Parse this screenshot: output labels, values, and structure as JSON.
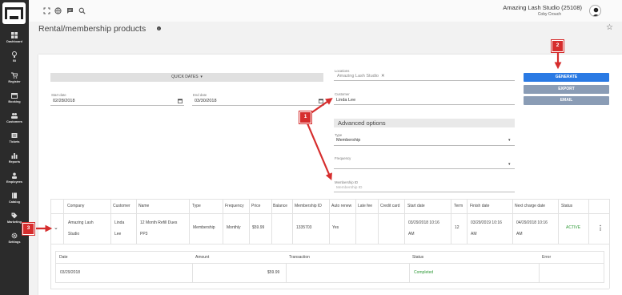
{
  "sidebar": {
    "items": [
      {
        "label": "Dashboard",
        "icon": "dashboard-icon"
      },
      {
        "label": "BI",
        "icon": "lightbulb-icon"
      },
      {
        "label": "Register",
        "icon": "cart-icon"
      },
      {
        "label": "Booking",
        "icon": "calendar-icon"
      },
      {
        "label": "Customers",
        "icon": "people-icon"
      },
      {
        "label": "Tickets",
        "icon": "ticket-icon"
      },
      {
        "label": "Reports",
        "icon": "bar-chart-icon"
      },
      {
        "label": "Employees",
        "icon": "person-icon"
      },
      {
        "label": "Catalog",
        "icon": "book-icon"
      },
      {
        "label": "Marketing",
        "icon": "tag-icon"
      },
      {
        "label": "Settings",
        "icon": "gear-icon"
      }
    ]
  },
  "header": {
    "studio": "Amazing Lash Studio (25108)",
    "user": "Coby Crouch"
  },
  "page": {
    "title": "Rental/membership products",
    "info": "i"
  },
  "filters": {
    "quick_dates": "QUICK DATES",
    "start_date_label": "Start date",
    "start_date": "02/28/2018",
    "end_date_label": "End date",
    "end_date": "03/30/2018",
    "locations_label": "Locations",
    "location_chip": "Amazing Lash Studio",
    "customer_label": "Customer",
    "customer": "Linda Lee",
    "advanced": "Advanced options",
    "type_label": "Type",
    "type": "Membership",
    "frequency_label": "Frequency",
    "frequency": "",
    "membership_id_label": "Membership ID",
    "membership_id_placeholder": "Membership ID"
  },
  "buttons": {
    "generate": "GENERATE",
    "export": "EXPORT",
    "email": "EMAIL"
  },
  "table": {
    "headers": [
      "Company",
      "Customer",
      "Name",
      "Type",
      "Frequency",
      "Price",
      "Balance",
      "Membership ID",
      "Auto renew",
      "Late fee",
      "Credit card",
      "Start date",
      "Term",
      "Finish date",
      "Next charge date",
      "Status"
    ],
    "row": {
      "company_1": "Amazing Lash",
      "company_2": "Studio",
      "customer_1": "Linda",
      "customer_2": "Lee",
      "name_1": "12 Month Refill Dues",
      "name_2": "PP3",
      "type": "Membership",
      "frequency": "Monthly",
      "price": "$59.99",
      "balance": "",
      "membership_id": "1335703",
      "auto_renew": "Yes",
      "late_fee": "",
      "credit_card": "",
      "start_1": "03/29/2018 10:16",
      "start_2": "AM",
      "term": "12",
      "finish_1": "03/29/2019 10:16",
      "finish_2": "AM",
      "next_1": "04/29/2018 10:16",
      "next_2": "AM",
      "status": "ACTIVE"
    },
    "sub_headers": [
      "Date",
      "Amount",
      "Transaction",
      "Status",
      "Error"
    ],
    "sub_row": {
      "date": "03/29/2018",
      "amount": "$59.99",
      "transaction": "",
      "status": "Completed",
      "error": ""
    }
  },
  "annotations": {
    "badge_1": "1",
    "badge_2": "2",
    "badge_3": "3",
    "color": "#d62d2d"
  },
  "colors": {
    "primary": "#2a7ae4",
    "secondary": "#8a9cb5",
    "sidebar": "#2b2b2b",
    "active": "#2e9a36"
  }
}
